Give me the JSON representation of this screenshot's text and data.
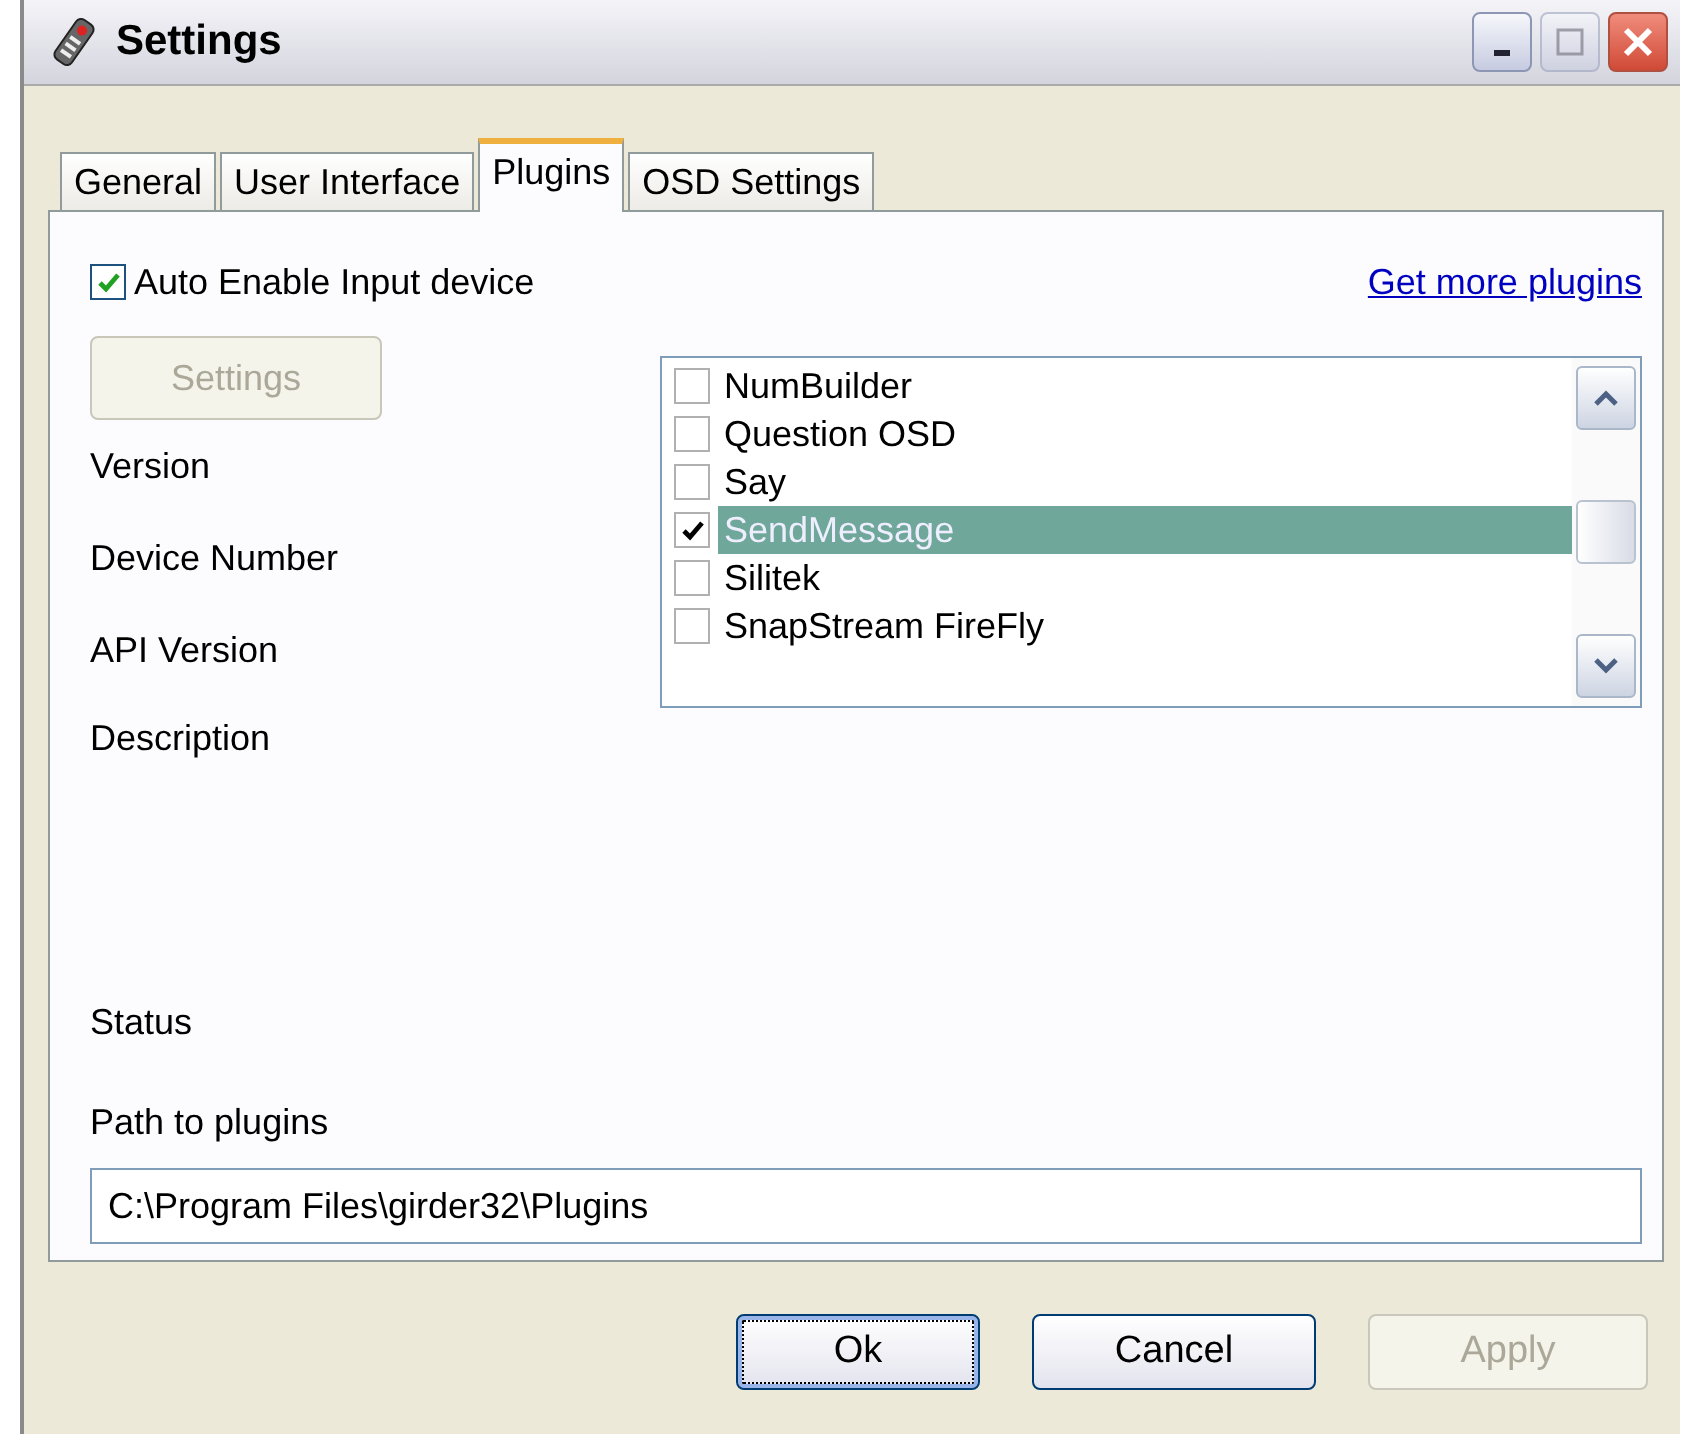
{
  "window": {
    "title": "Settings"
  },
  "tabs": [
    {
      "label": "General",
      "selected": false
    },
    {
      "label": "User Interface",
      "selected": false
    },
    {
      "label": "Plugins",
      "selected": true
    },
    {
      "label": "OSD Settings",
      "selected": false
    }
  ],
  "auto_enable": {
    "label": "Auto Enable Input device",
    "checked": true
  },
  "link": "Get more plugins",
  "settings_button": {
    "label": "Settings",
    "disabled": true
  },
  "plugins": [
    {
      "name": "NumBuilder",
      "checked": false,
      "selected": false
    },
    {
      "name": "Question OSD",
      "checked": false,
      "selected": false
    },
    {
      "name": "Say",
      "checked": false,
      "selected": false
    },
    {
      "name": "SendMessage",
      "checked": true,
      "selected": true
    },
    {
      "name": "Silitek",
      "checked": false,
      "selected": false
    },
    {
      "name": "SnapStream FireFly",
      "checked": false,
      "selected": false
    }
  ],
  "fields": [
    {
      "label": "Version",
      "kind": "line"
    },
    {
      "label": "Device Number",
      "kind": "line"
    },
    {
      "label": "API Version",
      "kind": "line"
    },
    {
      "label": "Description",
      "kind": "multiline"
    },
    {
      "label": "Status",
      "kind": "line"
    }
  ],
  "path": {
    "label": "Path to plugins",
    "value": "C:\\Program Files\\girder32\\Plugins"
  },
  "buttons": [
    {
      "label": "Ok",
      "default": true,
      "disabled": false
    },
    {
      "label": "Cancel",
      "default": false,
      "disabled": false
    },
    {
      "label": "Apply",
      "default": false,
      "disabled": true
    }
  ]
}
